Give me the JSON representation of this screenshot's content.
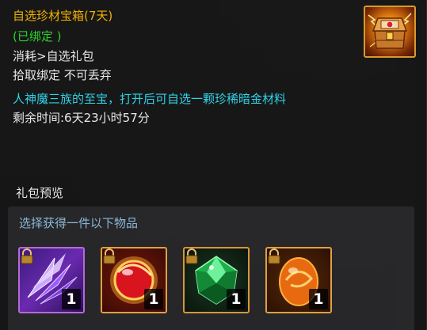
{
  "tooltip": {
    "title": "自选珍材宝箱(7天)",
    "bound_status": "(已绑定 )",
    "consume": "消耗>自选礼包",
    "pickup_rule": "拾取绑定 不可丢弃",
    "description": "人神魔三族的至宝，打开后可自选一颗珍稀暗金材料",
    "time_remaining": "剩余时间:6天23小时57分",
    "icon": "golden-treasure-chest-icon",
    "colors": {
      "title": "#f0b000",
      "bound": "#2bd12b",
      "description": "#2fd3e8",
      "normal": "#e8e8e8"
    }
  },
  "preview": {
    "label": "礼包预览",
    "choose_text": "选择获得一件以下物品",
    "items": [
      {
        "icon": "purple-crystal-shard-icon",
        "quantity": "1",
        "locked": true
      },
      {
        "icon": "red-orb-icon",
        "quantity": "1",
        "locked": true
      },
      {
        "icon": "green-gem-icon",
        "quantity": "1",
        "locked": true
      },
      {
        "icon": "orange-egg-orb-icon",
        "quantity": "1",
        "locked": true
      }
    ]
  }
}
